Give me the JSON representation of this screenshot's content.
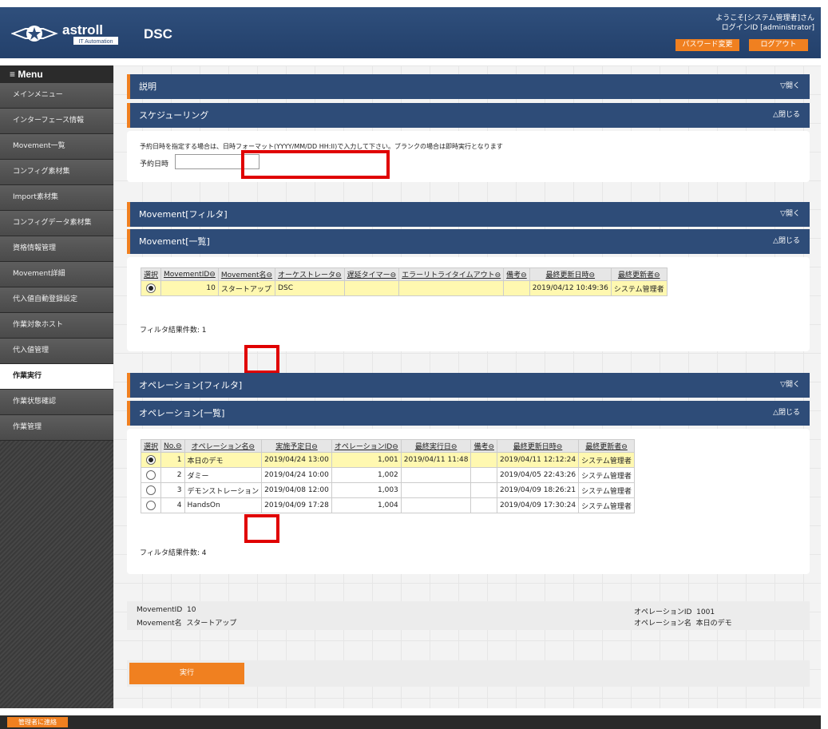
{
  "header": {
    "title": "DSC",
    "logo_text": "astroll",
    "logo_sub": "IT Automation",
    "welcome": "ようこそ[システム管理者]さん",
    "login_id": "ログインID [administrator]",
    "password_btn": "パスワード変更",
    "logout_btn": "ログアウト"
  },
  "menu": {
    "title": "≡ Menu",
    "items": [
      "メインメニュー",
      "インターフェース情報",
      "Movement一覧",
      "コンフィグ素材集",
      "Import素材集",
      "コンフィグデータ素材集",
      "資格情報管理",
      "Movement詳細",
      "代入値自動登録設定",
      "作業対象ホスト",
      "代入値管理",
      "作業実行",
      "作業状態確認",
      "作業管理"
    ],
    "active_index": 11
  },
  "sections": {
    "desc": {
      "title": "説明",
      "toggle": "▽開く"
    },
    "schedule": {
      "title": "スケジューリング",
      "toggle": "△閉じる",
      "note": "予約日時を指定する場合は、日時フォーマット(YYYY/MM/DD HH:II)で入力して下さい。ブランクの場合は即時実行となります",
      "label": "予約日時",
      "value": ""
    },
    "mv_filter": {
      "title": "Movement[フィルタ]",
      "toggle": "▽開く"
    },
    "mv_list": {
      "title": "Movement[一覧]",
      "toggle": "△閉じる",
      "headers": [
        "選択",
        "MovementID⊖",
        "Movement名⊖",
        "オーケストレータ⊖",
        "遅延タイマー⊖",
        "エラーリトライタイムアウト⊖",
        "備考⊖",
        "最終更新日時⊖",
        "最終更新者⊖"
      ],
      "rows": [
        [
          "",
          "10",
          "スタートアップ",
          "DSC",
          "",
          "",
          "",
          "2019/04/12 10:49:36",
          "システム管理者"
        ]
      ],
      "count": "フィルタ結果件数: 1"
    },
    "op_filter": {
      "title": "オペレーション[フィルタ]",
      "toggle": "▽開く"
    },
    "op_list": {
      "title": "オペレーション[一覧]",
      "toggle": "△閉じる",
      "headers": [
        "選択",
        "No.⊖",
        "オペレーション名⊖",
        "実施予定日⊖",
        "オペレーションID⊖",
        "最終実行日⊖",
        "備考⊖",
        "最終更新日時⊖",
        "最終更新者⊖"
      ],
      "rows": [
        [
          "",
          "1",
          "本日のデモ",
          "2019/04/24 13:00",
          "1,001",
          "2019/04/11 11:48",
          "",
          "2019/04/11 12:12:24",
          "システム管理者"
        ],
        [
          "",
          "2",
          "ダミー",
          "2019/04/24 10:00",
          "1,002",
          "",
          "",
          "2019/04/05 22:43:26",
          "システム管理者"
        ],
        [
          "",
          "3",
          "デモンストレーション",
          "2019/04/08 12:00",
          "1,003",
          "",
          "",
          "2019/04/09 18:26:21",
          "システム管理者"
        ],
        [
          "",
          "4",
          "HandsOn",
          "2019/04/09 17:28",
          "1,004",
          "",
          "",
          "2019/04/09 17:30:24",
          "システム管理者"
        ]
      ],
      "selected_row": 0,
      "count": "フィルタ結果件数: 4"
    }
  },
  "summary": {
    "mv_id_label": "MovementID",
    "mv_id": "10",
    "mv_name_label": "Movement名",
    "mv_name": "スタートアップ",
    "op_id_label": "オペレーションID",
    "op_id": "1001",
    "op_name_label": "オペレーション名",
    "op_name": "本日のデモ"
  },
  "execute_label": "実行",
  "footer_btn": "管理者に連絡",
  "colors": {
    "header": "#2e4c78",
    "accent": "#f08020",
    "highlight": "#e00000"
  }
}
